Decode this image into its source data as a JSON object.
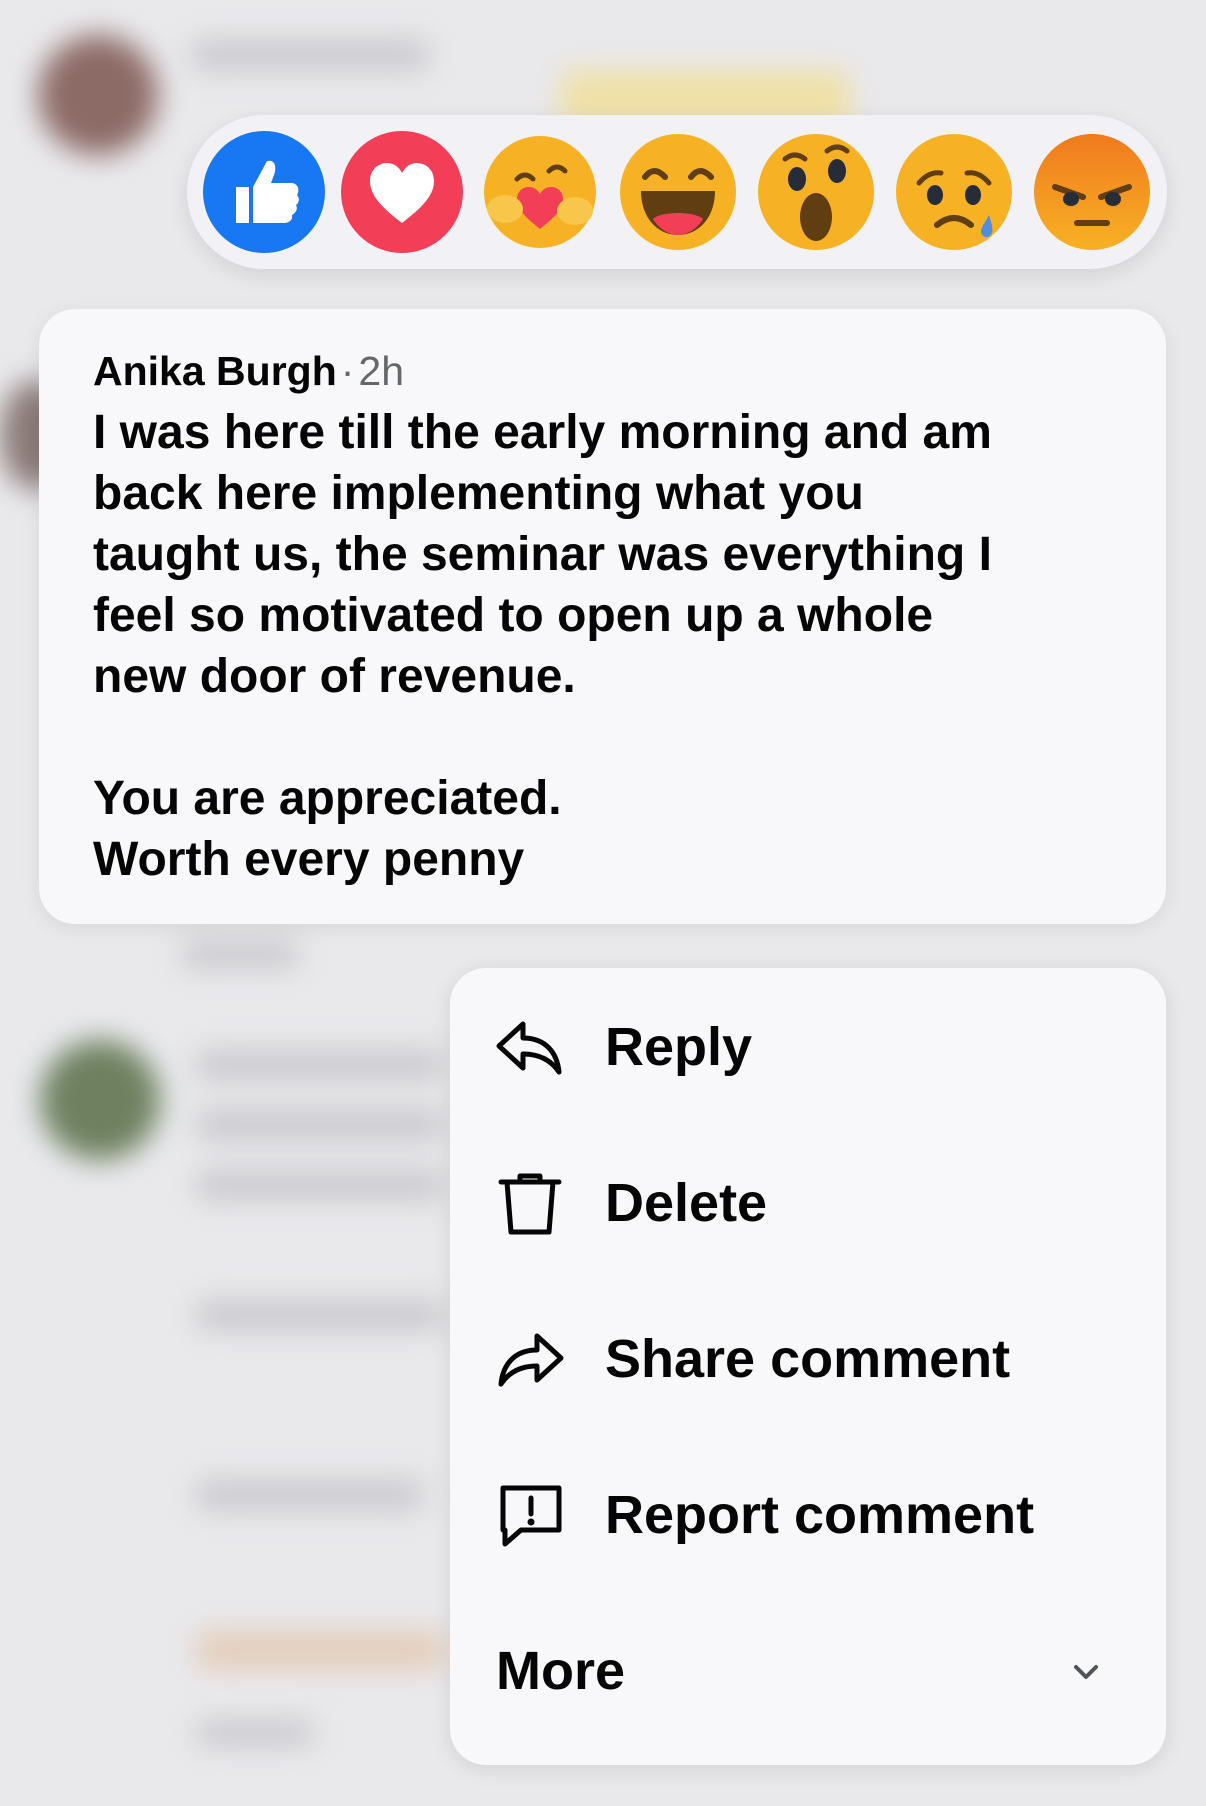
{
  "reactions": [
    {
      "name": "Like",
      "icon": "like-icon",
      "color": "#1877f2"
    },
    {
      "name": "Love",
      "icon": "love-icon",
      "color": "#f33e58"
    },
    {
      "name": "Care",
      "icon": "care-icon",
      "color": "#f7b125"
    },
    {
      "name": "Haha",
      "icon": "haha-icon",
      "color": "#f7b125"
    },
    {
      "name": "Wow",
      "icon": "wow-icon",
      "color": "#f7b125"
    },
    {
      "name": "Sad",
      "icon": "sad-icon",
      "color": "#f7b125"
    },
    {
      "name": "Angry",
      "icon": "angry-icon",
      "color": "#e9710f"
    }
  ],
  "comment": {
    "author": "Anika Burgh",
    "separator": "·",
    "time": "2h",
    "lines": [
      "I was here till the early morning and am",
      "back here implementing what you",
      "taught us, the seminar was everything I",
      "feel so motivated to open up a whole",
      "new door of revenue."
    ],
    "lines2": [
      "You are appreciated.",
      "Worth every penny"
    ]
  },
  "menu": {
    "reply": "Reply",
    "delete": "Delete",
    "share": "Share comment",
    "report": "Report comment",
    "more": "More"
  }
}
